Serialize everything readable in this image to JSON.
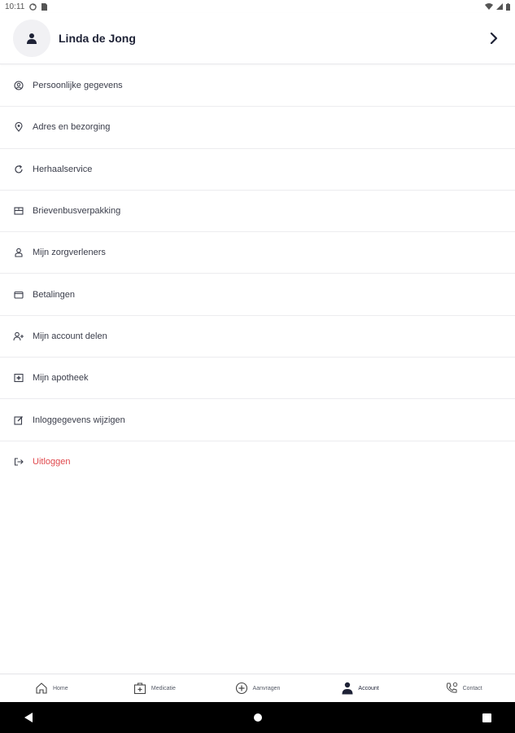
{
  "status_bar": {
    "time": "10:11"
  },
  "profile": {
    "name": "Linda de Jong"
  },
  "menu": {
    "items": [
      {
        "label": "Persoonlijke gegevens",
        "icon": "user-circle-icon"
      },
      {
        "label": "Adres en bezorging",
        "icon": "location-pin-icon"
      },
      {
        "label": "Herhaalservice",
        "icon": "refresh-icon"
      },
      {
        "label": "Brievenbusverpakking",
        "icon": "package-icon"
      },
      {
        "label": "Mijn zorgverleners",
        "icon": "caregiver-icon"
      },
      {
        "label": "Betalingen",
        "icon": "wallet-icon"
      },
      {
        "label": "Mijn account delen",
        "icon": "user-add-icon"
      },
      {
        "label": "Mijn apotheek",
        "icon": "pharmacy-icon"
      },
      {
        "label": "Inloggegevens wijzigen",
        "icon": "edit-icon"
      },
      {
        "label": "Uitloggen",
        "icon": "logout-icon"
      }
    ]
  },
  "bottom_nav": {
    "items": [
      {
        "label": "Home",
        "icon": "home-icon"
      },
      {
        "label": "Medicatie",
        "icon": "medkit-icon"
      },
      {
        "label": "Aanvragen",
        "icon": "plus-circle-icon"
      },
      {
        "label": "Account",
        "icon": "person-icon"
      },
      {
        "label": "Contact",
        "icon": "phone-icon"
      }
    ],
    "active": "Account"
  },
  "colors": {
    "text_primary": "#1e2236",
    "logout": "#e0484c",
    "divider": "#ececef",
    "system_nav": "#000000"
  }
}
